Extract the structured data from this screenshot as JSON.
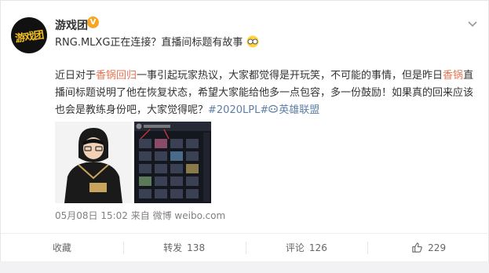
{
  "post": {
    "username": "游戏团",
    "avatar_text": "游戏团",
    "verified_mark": "V",
    "subtitle": "RNG.MLXG正在连接？直播间标题有故事",
    "body": {
      "t1": "近日对于",
      "h1": "香锅回归",
      "t2": "一事引起玩家热议，大家都觉得是开玩笑，不可能的事情，但是昨日",
      "h2": "香锅",
      "t3": "直播间标题说明了他在恢复状态，希望大家能给他多一点包容，多一份鼓励！如果真的回来应该也会是教练身份吧，大家觉得呢？",
      "topic": "#2020LPL#",
      "tag": "英雄联盟"
    },
    "timestamp": "05月08日 15:02",
    "source_prefix": "来自",
    "source": "微博 weibo.com"
  },
  "actions": {
    "favorite_label": "收藏",
    "repost_label": "转发",
    "repost_count": "138",
    "comment_label": "评论",
    "comment_count": "126",
    "like_count": "229"
  },
  "colors": {
    "highlight": "#eb7350",
    "link": "#5d7ea6",
    "verified": "#f6a623"
  },
  "icons": [
    "glasses-emoji-icon",
    "chevron-down-icon",
    "verified-icon",
    "game-tag-icon",
    "repost-icon",
    "comment-icon",
    "like-icon"
  ]
}
